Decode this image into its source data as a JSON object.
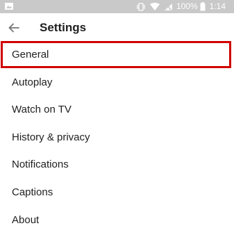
{
  "status_bar": {
    "battery_percent": "100%",
    "time": "1:14",
    "icons": [
      "image-icon",
      "vibrate-icon",
      "wifi-icon",
      "signal-off-icon",
      "battery-icon"
    ]
  },
  "app_bar": {
    "back_icon": "arrow-left-icon",
    "title": "Settings"
  },
  "menu": {
    "items": [
      {
        "label": "General",
        "highlighted": true
      },
      {
        "label": "Autoplay"
      },
      {
        "label": "Watch on TV"
      },
      {
        "label": "History & privacy"
      },
      {
        "label": "Notifications"
      },
      {
        "label": "Captions"
      },
      {
        "label": "About"
      }
    ]
  },
  "colors": {
    "status_bar_bg": "#c9c9c9",
    "highlight_border": "#d00000",
    "text": "#212121"
  }
}
